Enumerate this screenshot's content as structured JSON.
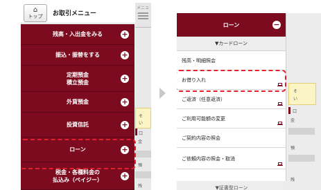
{
  "left_panel": {
    "background_page": {
      "menu_label": "メニュー",
      "side_texts": [
        "そ",
        "い",
        "口",
        "金",
        "預",
        "残"
      ]
    },
    "drawer": {
      "top_button_label": "トップ",
      "title": "お取引メニュー",
      "items": [
        {
          "label": "残高・入出金をみる"
        },
        {
          "label": "振込・振替をする"
        },
        {
          "label": "定期預金\n積立預金"
        },
        {
          "label": "外貨預金"
        },
        {
          "label": "投資信託"
        },
        {
          "label": "ローン"
        },
        {
          "label": "税金・各種料金の\n払込み（ペイジー）"
        }
      ]
    }
  },
  "right_panel": {
    "header_title": "ローン",
    "section_label": "▼カードローン",
    "items": [
      {
        "label": "残高・明細照会",
        "has_icon": false
      },
      {
        "label": "お借り入れ",
        "has_icon": true
      },
      {
        "label": "ご返済（任意返済）",
        "has_icon": true
      },
      {
        "label": "ご利用可能額の変更",
        "has_icon": true
      },
      {
        "label": "ご契約内容の照会",
        "has_icon": false
      },
      {
        "label": "ご依頼内容の照会・取消",
        "has_icon": true
      }
    ],
    "footer_partial": "▼証書型ローン",
    "background_page": {
      "side_texts": [
        "そ",
        "い",
        "口",
        "金",
        "預",
        "残"
      ]
    }
  },
  "colors": {
    "brand": "#7d0b1f",
    "highlight": "#e0202a",
    "section_bg": "#ededed"
  }
}
